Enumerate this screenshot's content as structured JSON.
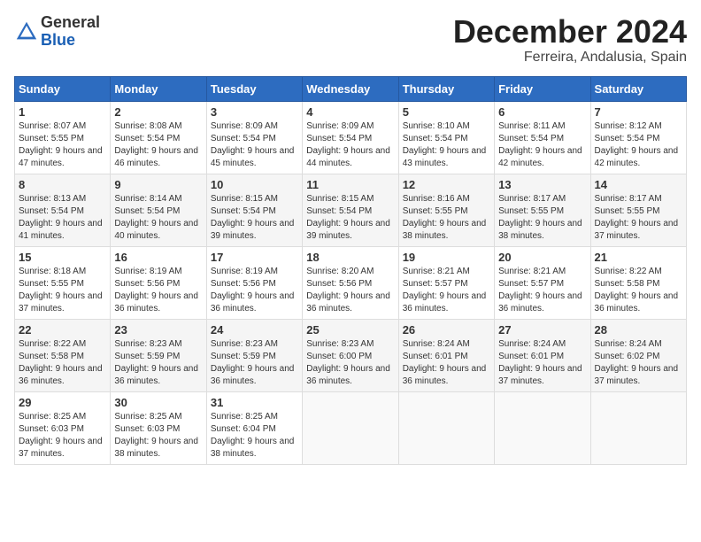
{
  "header": {
    "logo_general": "General",
    "logo_blue": "Blue",
    "month_title": "December 2024",
    "location": "Ferreira, Andalusia, Spain"
  },
  "calendar": {
    "headers": [
      "Sunday",
      "Monday",
      "Tuesday",
      "Wednesday",
      "Thursday",
      "Friday",
      "Saturday"
    ],
    "weeks": [
      [
        {
          "day": "1",
          "sunrise": "8:07 AM",
          "sunset": "5:55 PM",
          "daylight": "9 hours and 47 minutes."
        },
        {
          "day": "2",
          "sunrise": "8:08 AM",
          "sunset": "5:54 PM",
          "daylight": "9 hours and 46 minutes."
        },
        {
          "day": "3",
          "sunrise": "8:09 AM",
          "sunset": "5:54 PM",
          "daylight": "9 hours and 45 minutes."
        },
        {
          "day": "4",
          "sunrise": "8:09 AM",
          "sunset": "5:54 PM",
          "daylight": "9 hours and 44 minutes."
        },
        {
          "day": "5",
          "sunrise": "8:10 AM",
          "sunset": "5:54 PM",
          "daylight": "9 hours and 43 minutes."
        },
        {
          "day": "6",
          "sunrise": "8:11 AM",
          "sunset": "5:54 PM",
          "daylight": "9 hours and 42 minutes."
        },
        {
          "day": "7",
          "sunrise": "8:12 AM",
          "sunset": "5:54 PM",
          "daylight": "9 hours and 42 minutes."
        }
      ],
      [
        {
          "day": "8",
          "sunrise": "8:13 AM",
          "sunset": "5:54 PM",
          "daylight": "9 hours and 41 minutes."
        },
        {
          "day": "9",
          "sunrise": "8:14 AM",
          "sunset": "5:54 PM",
          "daylight": "9 hours and 40 minutes."
        },
        {
          "day": "10",
          "sunrise": "8:15 AM",
          "sunset": "5:54 PM",
          "daylight": "9 hours and 39 minutes."
        },
        {
          "day": "11",
          "sunrise": "8:15 AM",
          "sunset": "5:54 PM",
          "daylight": "9 hours and 39 minutes."
        },
        {
          "day": "12",
          "sunrise": "8:16 AM",
          "sunset": "5:55 PM",
          "daylight": "9 hours and 38 minutes."
        },
        {
          "day": "13",
          "sunrise": "8:17 AM",
          "sunset": "5:55 PM",
          "daylight": "9 hours and 38 minutes."
        },
        {
          "day": "14",
          "sunrise": "8:17 AM",
          "sunset": "5:55 PM",
          "daylight": "9 hours and 37 minutes."
        }
      ],
      [
        {
          "day": "15",
          "sunrise": "8:18 AM",
          "sunset": "5:55 PM",
          "daylight": "9 hours and 37 minutes."
        },
        {
          "day": "16",
          "sunrise": "8:19 AM",
          "sunset": "5:56 PM",
          "daylight": "9 hours and 36 minutes."
        },
        {
          "day": "17",
          "sunrise": "8:19 AM",
          "sunset": "5:56 PM",
          "daylight": "9 hours and 36 minutes."
        },
        {
          "day": "18",
          "sunrise": "8:20 AM",
          "sunset": "5:56 PM",
          "daylight": "9 hours and 36 minutes."
        },
        {
          "day": "19",
          "sunrise": "8:21 AM",
          "sunset": "5:57 PM",
          "daylight": "9 hours and 36 minutes."
        },
        {
          "day": "20",
          "sunrise": "8:21 AM",
          "sunset": "5:57 PM",
          "daylight": "9 hours and 36 minutes."
        },
        {
          "day": "21",
          "sunrise": "8:22 AM",
          "sunset": "5:58 PM",
          "daylight": "9 hours and 36 minutes."
        }
      ],
      [
        {
          "day": "22",
          "sunrise": "8:22 AM",
          "sunset": "5:58 PM",
          "daylight": "9 hours and 36 minutes."
        },
        {
          "day": "23",
          "sunrise": "8:23 AM",
          "sunset": "5:59 PM",
          "daylight": "9 hours and 36 minutes."
        },
        {
          "day": "24",
          "sunrise": "8:23 AM",
          "sunset": "5:59 PM",
          "daylight": "9 hours and 36 minutes."
        },
        {
          "day": "25",
          "sunrise": "8:23 AM",
          "sunset": "6:00 PM",
          "daylight": "9 hours and 36 minutes."
        },
        {
          "day": "26",
          "sunrise": "8:24 AM",
          "sunset": "6:01 PM",
          "daylight": "9 hours and 36 minutes."
        },
        {
          "day": "27",
          "sunrise": "8:24 AM",
          "sunset": "6:01 PM",
          "daylight": "9 hours and 37 minutes."
        },
        {
          "day": "28",
          "sunrise": "8:24 AM",
          "sunset": "6:02 PM",
          "daylight": "9 hours and 37 minutes."
        }
      ],
      [
        {
          "day": "29",
          "sunrise": "8:25 AM",
          "sunset": "6:03 PM",
          "daylight": "9 hours and 37 minutes."
        },
        {
          "day": "30",
          "sunrise": "8:25 AM",
          "sunset": "6:03 PM",
          "daylight": "9 hours and 38 minutes."
        },
        {
          "day": "31",
          "sunrise": "8:25 AM",
          "sunset": "6:04 PM",
          "daylight": "9 hours and 38 minutes."
        },
        null,
        null,
        null,
        null
      ]
    ]
  }
}
